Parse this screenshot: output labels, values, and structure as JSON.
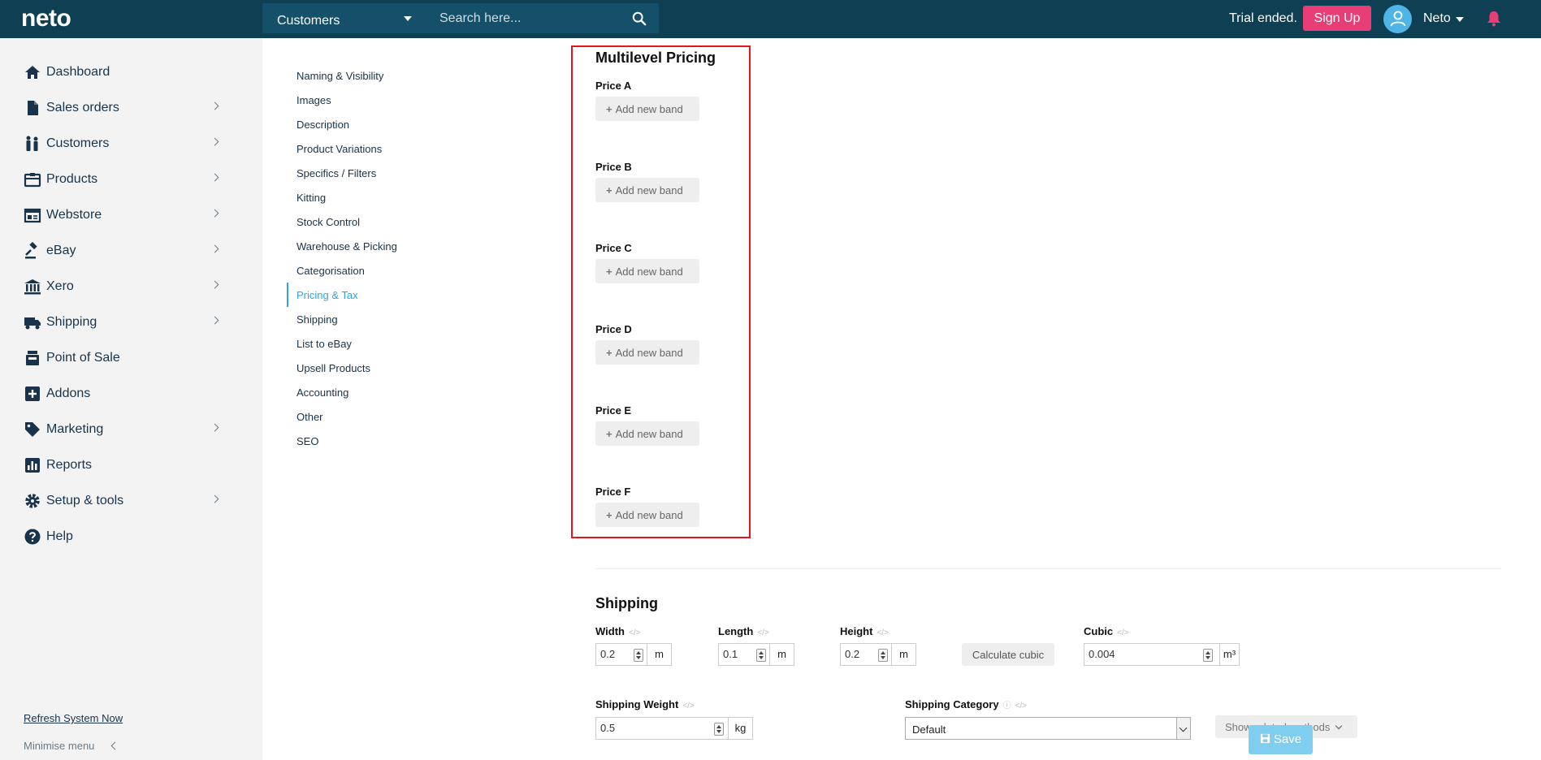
{
  "header": {
    "logo": "neto",
    "module_select": "Customers",
    "search_placeholder": "Search here...",
    "trial_text": "Trial ended.",
    "signup_label": "Sign Up",
    "user_name": "Neto"
  },
  "sidebar": {
    "items": [
      {
        "label": "Dashboard",
        "icon": "home-icon",
        "has_chevron": false
      },
      {
        "label": "Sales orders",
        "icon": "document-icon",
        "has_chevron": true
      },
      {
        "label": "Customers",
        "icon": "people-icon",
        "has_chevron": true
      },
      {
        "label": "Products",
        "icon": "box-icon",
        "has_chevron": true
      },
      {
        "label": "Webstore",
        "icon": "browser-icon",
        "has_chevron": true
      },
      {
        "label": "eBay",
        "icon": "gavel-icon",
        "has_chevron": true
      },
      {
        "label": "Xero",
        "icon": "bank-icon",
        "has_chevron": true
      },
      {
        "label": "Shipping",
        "icon": "truck-icon",
        "has_chevron": true
      },
      {
        "label": "Point of Sale",
        "icon": "pos-icon",
        "has_chevron": false
      },
      {
        "label": "Addons",
        "icon": "plus-square-icon",
        "has_chevron": false
      },
      {
        "label": "Marketing",
        "icon": "tag-icon",
        "has_chevron": true
      },
      {
        "label": "Reports",
        "icon": "bar-chart-icon",
        "has_chevron": false
      },
      {
        "label": "Setup & tools",
        "icon": "gear-icon",
        "has_chevron": true
      },
      {
        "label": "Help",
        "icon": "question-icon",
        "has_chevron": false
      }
    ],
    "refresh_label": "Refresh System Now",
    "minimise_label": "Minimise menu"
  },
  "subnav": {
    "items": [
      "Naming & Visibility",
      "Images",
      "Description",
      "Product Variations",
      "Specifics / Filters",
      "Kitting",
      "Stock Control",
      "Warehouse & Picking",
      "Categorisation",
      "Pricing & Tax",
      "Shipping",
      "List to eBay",
      "Upsell Products",
      "Accounting",
      "Other",
      "SEO"
    ],
    "active": "Pricing & Tax"
  },
  "multilevel": {
    "title": "Multilevel Pricing",
    "add_band_label": "Add new band",
    "prices": [
      "Price A",
      "Price B",
      "Price C",
      "Price D",
      "Price E",
      "Price F"
    ]
  },
  "shipping": {
    "title": "Shipping",
    "width": {
      "label": "Width",
      "value": "0.2",
      "unit": "m"
    },
    "length": {
      "label": "Length",
      "value": "0.1",
      "unit": "m"
    },
    "height": {
      "label": "Height",
      "value": "0.2",
      "unit": "m"
    },
    "calc_label": "Calculate cubic",
    "cubic": {
      "label": "Cubic",
      "value": "0.004",
      "unit": "m³"
    },
    "weight": {
      "label": "Shipping Weight",
      "value": "0.5",
      "unit": "kg"
    },
    "category": {
      "label": "Shipping Category",
      "value": "Default"
    },
    "related_label": "Show related methods",
    "save_label": "Save",
    "tag_glyph": "</>"
  },
  "colors": {
    "topbar": "#0f3f52",
    "accent": "#2aa6d8",
    "signup": "#e83e76",
    "highlight": "#e8131b"
  }
}
